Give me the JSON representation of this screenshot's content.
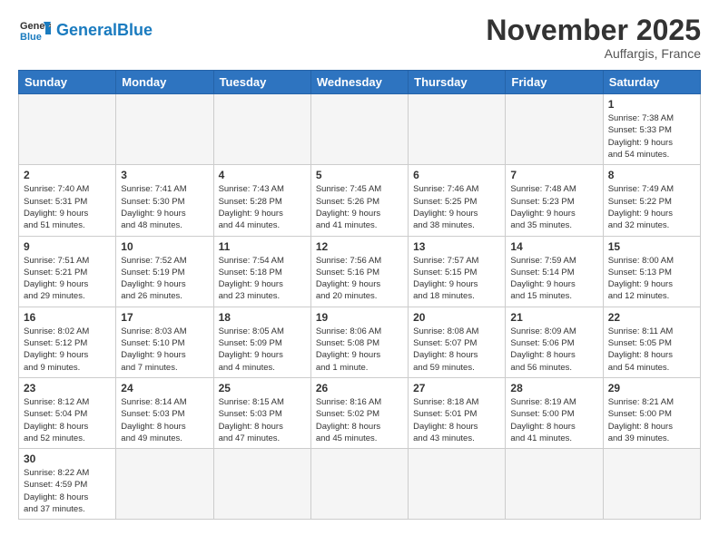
{
  "header": {
    "logo_general": "General",
    "logo_blue": "Blue",
    "month_title": "November 2025",
    "location": "Auffargis, France"
  },
  "weekdays": [
    "Sunday",
    "Monday",
    "Tuesday",
    "Wednesday",
    "Thursday",
    "Friday",
    "Saturday"
  ],
  "weeks": [
    [
      {
        "day": "",
        "info": ""
      },
      {
        "day": "",
        "info": ""
      },
      {
        "day": "",
        "info": ""
      },
      {
        "day": "",
        "info": ""
      },
      {
        "day": "",
        "info": ""
      },
      {
        "day": "",
        "info": ""
      },
      {
        "day": "1",
        "info": "Sunrise: 7:38 AM\nSunset: 5:33 PM\nDaylight: 9 hours\nand 54 minutes."
      }
    ],
    [
      {
        "day": "2",
        "info": "Sunrise: 7:40 AM\nSunset: 5:31 PM\nDaylight: 9 hours\nand 51 minutes."
      },
      {
        "day": "3",
        "info": "Sunrise: 7:41 AM\nSunset: 5:30 PM\nDaylight: 9 hours\nand 48 minutes."
      },
      {
        "day": "4",
        "info": "Sunrise: 7:43 AM\nSunset: 5:28 PM\nDaylight: 9 hours\nand 44 minutes."
      },
      {
        "day": "5",
        "info": "Sunrise: 7:45 AM\nSunset: 5:26 PM\nDaylight: 9 hours\nand 41 minutes."
      },
      {
        "day": "6",
        "info": "Sunrise: 7:46 AM\nSunset: 5:25 PM\nDaylight: 9 hours\nand 38 minutes."
      },
      {
        "day": "7",
        "info": "Sunrise: 7:48 AM\nSunset: 5:23 PM\nDaylight: 9 hours\nand 35 minutes."
      },
      {
        "day": "8",
        "info": "Sunrise: 7:49 AM\nSunset: 5:22 PM\nDaylight: 9 hours\nand 32 minutes."
      }
    ],
    [
      {
        "day": "9",
        "info": "Sunrise: 7:51 AM\nSunset: 5:21 PM\nDaylight: 9 hours\nand 29 minutes."
      },
      {
        "day": "10",
        "info": "Sunrise: 7:52 AM\nSunset: 5:19 PM\nDaylight: 9 hours\nand 26 minutes."
      },
      {
        "day": "11",
        "info": "Sunrise: 7:54 AM\nSunset: 5:18 PM\nDaylight: 9 hours\nand 23 minutes."
      },
      {
        "day": "12",
        "info": "Sunrise: 7:56 AM\nSunset: 5:16 PM\nDaylight: 9 hours\nand 20 minutes."
      },
      {
        "day": "13",
        "info": "Sunrise: 7:57 AM\nSunset: 5:15 PM\nDaylight: 9 hours\nand 18 minutes."
      },
      {
        "day": "14",
        "info": "Sunrise: 7:59 AM\nSunset: 5:14 PM\nDaylight: 9 hours\nand 15 minutes."
      },
      {
        "day": "15",
        "info": "Sunrise: 8:00 AM\nSunset: 5:13 PM\nDaylight: 9 hours\nand 12 minutes."
      }
    ],
    [
      {
        "day": "16",
        "info": "Sunrise: 8:02 AM\nSunset: 5:12 PM\nDaylight: 9 hours\nand 9 minutes."
      },
      {
        "day": "17",
        "info": "Sunrise: 8:03 AM\nSunset: 5:10 PM\nDaylight: 9 hours\nand 7 minutes."
      },
      {
        "day": "18",
        "info": "Sunrise: 8:05 AM\nSunset: 5:09 PM\nDaylight: 9 hours\nand 4 minutes."
      },
      {
        "day": "19",
        "info": "Sunrise: 8:06 AM\nSunset: 5:08 PM\nDaylight: 9 hours\nand 1 minute."
      },
      {
        "day": "20",
        "info": "Sunrise: 8:08 AM\nSunset: 5:07 PM\nDaylight: 8 hours\nand 59 minutes."
      },
      {
        "day": "21",
        "info": "Sunrise: 8:09 AM\nSunset: 5:06 PM\nDaylight: 8 hours\nand 56 minutes."
      },
      {
        "day": "22",
        "info": "Sunrise: 8:11 AM\nSunset: 5:05 PM\nDaylight: 8 hours\nand 54 minutes."
      }
    ],
    [
      {
        "day": "23",
        "info": "Sunrise: 8:12 AM\nSunset: 5:04 PM\nDaylight: 8 hours\nand 52 minutes."
      },
      {
        "day": "24",
        "info": "Sunrise: 8:14 AM\nSunset: 5:03 PM\nDaylight: 8 hours\nand 49 minutes."
      },
      {
        "day": "25",
        "info": "Sunrise: 8:15 AM\nSunset: 5:03 PM\nDaylight: 8 hours\nand 47 minutes."
      },
      {
        "day": "26",
        "info": "Sunrise: 8:16 AM\nSunset: 5:02 PM\nDaylight: 8 hours\nand 45 minutes."
      },
      {
        "day": "27",
        "info": "Sunrise: 8:18 AM\nSunset: 5:01 PM\nDaylight: 8 hours\nand 43 minutes."
      },
      {
        "day": "28",
        "info": "Sunrise: 8:19 AM\nSunset: 5:00 PM\nDaylight: 8 hours\nand 41 minutes."
      },
      {
        "day": "29",
        "info": "Sunrise: 8:21 AM\nSunset: 5:00 PM\nDaylight: 8 hours\nand 39 minutes."
      }
    ],
    [
      {
        "day": "30",
        "info": "Sunrise: 8:22 AM\nSunset: 4:59 PM\nDaylight: 8 hours\nand 37 minutes."
      },
      {
        "day": "",
        "info": ""
      },
      {
        "day": "",
        "info": ""
      },
      {
        "day": "",
        "info": ""
      },
      {
        "day": "",
        "info": ""
      },
      {
        "day": "",
        "info": ""
      },
      {
        "day": "",
        "info": ""
      }
    ]
  ]
}
